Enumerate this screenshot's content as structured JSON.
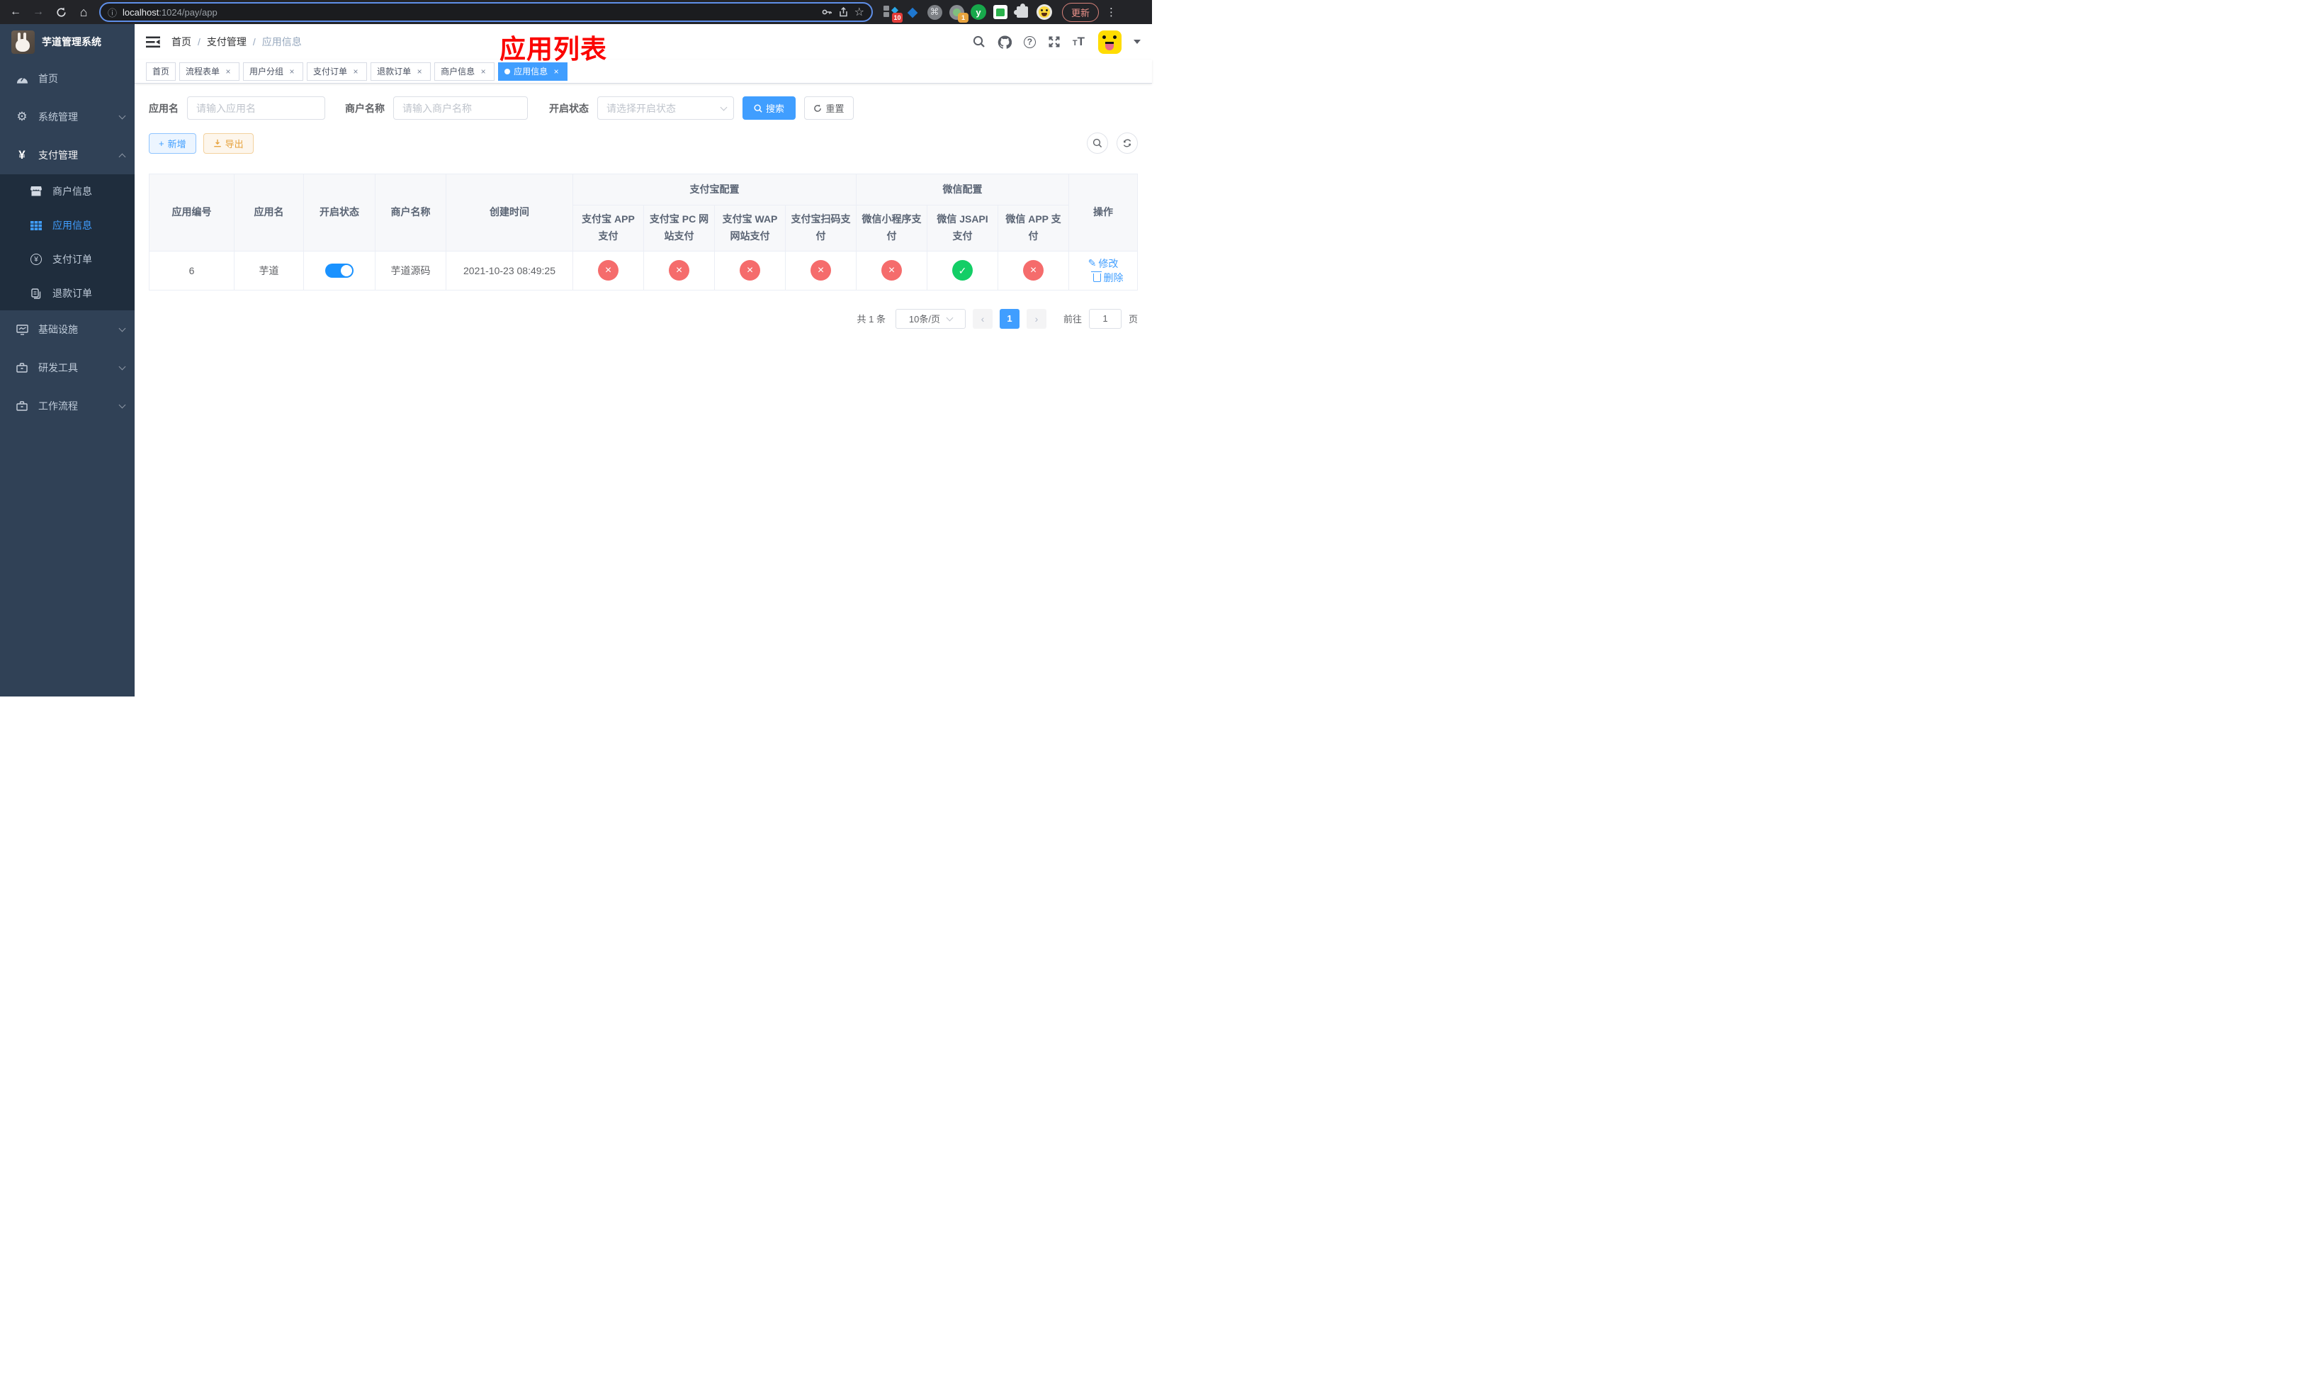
{
  "colors": {
    "accent": "#409eff",
    "danger": "#f56c6c",
    "success": "#13ce66",
    "warning": "#e6a23c",
    "annotation": "#fb0300",
    "sidebar_bg": "#304156",
    "submenu_bg": "#1f2d3d",
    "toggle_on": "#1a92ff"
  },
  "icons": {
    "back": "←",
    "forward": "→",
    "home": "⌂",
    "info": "ⓘ",
    "star": "☆",
    "cmd": "⌘",
    "gem": "◆",
    "kebab": "⋮",
    "close": "×",
    "sep": "/",
    "prev": "‹",
    "next": "›",
    "plus": "+",
    "yen": "¥",
    "gear": "⚙",
    "edit": "✎",
    "question": "?",
    "t_small": "T",
    "t_big": "T",
    "active_dot": "",
    "ext_letter": "y"
  },
  "browser": {
    "url_host": "localhost",
    "url_rest": ":1024/pay/app",
    "update_label": "更新",
    "ext_badge_a": "10",
    "ext_badge_b": "1"
  },
  "sidebar": {
    "title": "芋道管理系统",
    "items": [
      {
        "label": "首页"
      },
      {
        "label": "系统管理"
      },
      {
        "label": "支付管理"
      },
      {
        "label": "基础设施"
      },
      {
        "label": "研发工具"
      },
      {
        "label": "工作流程"
      }
    ],
    "sub_items": [
      {
        "label": "商户信息"
      },
      {
        "label": "应用信息"
      },
      {
        "label": "支付订单"
      },
      {
        "label": "退款订单"
      }
    ]
  },
  "navbar": {
    "breadcrumb": [
      "首页",
      "支付管理",
      "应用信息"
    ],
    "annotation": "应用列表"
  },
  "tabs": [
    {
      "label": "首页"
    },
    {
      "label": "流程表单"
    },
    {
      "label": "用户分组"
    },
    {
      "label": "支付订单"
    },
    {
      "label": "退款订单"
    },
    {
      "label": "商户信息"
    },
    {
      "label": "应用信息"
    }
  ],
  "filters": {
    "app_name_label": "应用名",
    "app_name_placeholder": "请输入应用名",
    "merchant_label": "商户名称",
    "merchant_placeholder": "请输入商户名称",
    "status_label": "开启状态",
    "status_placeholder": "请选择开启状态",
    "search_label": "搜索",
    "reset_label": "重置"
  },
  "toolbar": {
    "add_label": "新增",
    "export_label": "导出"
  },
  "table": {
    "columns": [
      "应用编号",
      "应用名",
      "开启状态",
      "商户名称",
      "创建时间"
    ],
    "groups": {
      "alipay": "支付宝配置",
      "wechat": "微信配置"
    },
    "pay_columns": [
      "支付宝 APP 支付",
      "支付宝 PC 网站支付",
      "支付宝 WAP 网站支付",
      "支付宝扫码支付",
      "微信小程序支付",
      "微信 JSAPI 支付",
      "微信 APP 支付"
    ],
    "action_label": "操作",
    "row": {
      "id": "6",
      "name": "芋道",
      "enabled": true,
      "merchant": "芋道源码",
      "created": "2021-10-23 08:49:25",
      "configs": [
        "red",
        "red",
        "red",
        "red",
        "red",
        "green",
        "red"
      ],
      "edit_label": "修改",
      "delete_label": "删除"
    }
  },
  "pagination": {
    "total": "共 1 条",
    "page_size": "10条/页",
    "page": "1",
    "goto_label": "前往",
    "goto_value": "1",
    "unit": "页"
  }
}
